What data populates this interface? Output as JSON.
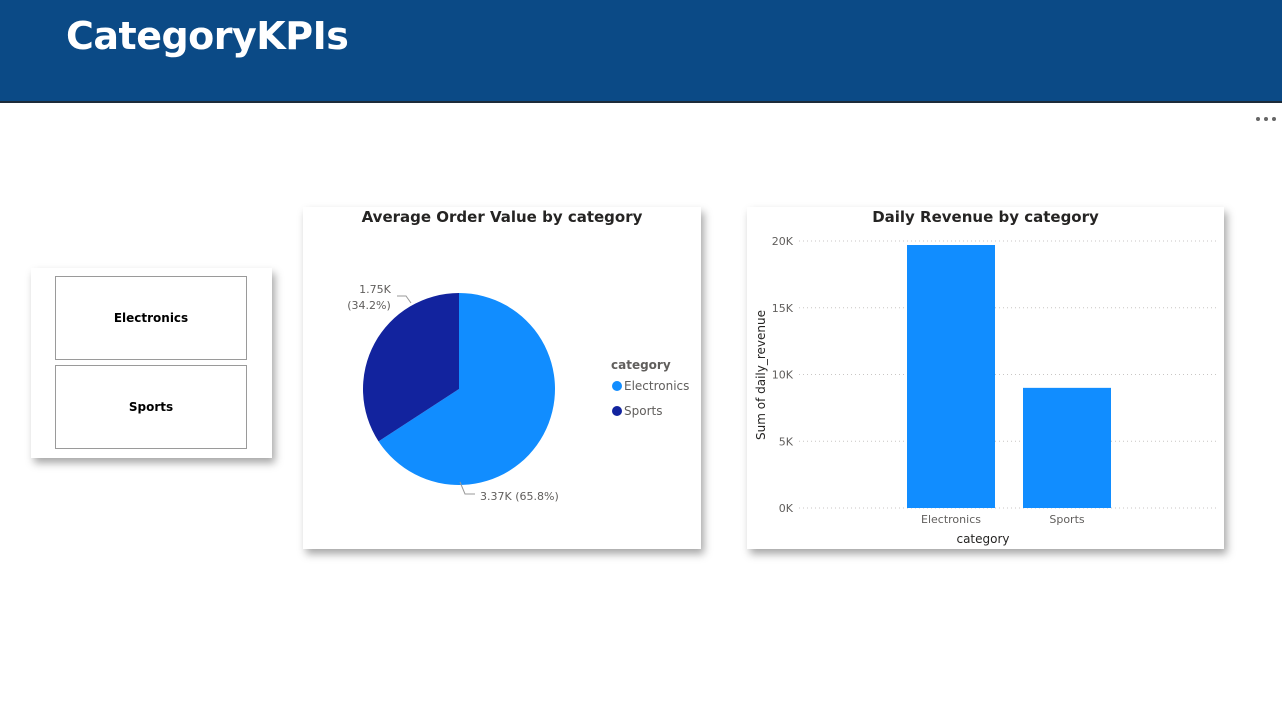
{
  "header": {
    "title": "CategoryKPIs"
  },
  "slicer": {
    "items": [
      "Electronics",
      "Sports"
    ]
  },
  "pie_chart": {
    "title": "Average Order Value by category",
    "legend_title": "category",
    "slices": [
      {
        "name": "Electronics",
        "value": 3370,
        "label": "3.37K (65.8%)",
        "color": "#118dff"
      },
      {
        "name": "Sports",
        "value": 1750,
        "label_line1": "1.75K",
        "label_line2": "(34.2%)",
        "color": "#12239e"
      }
    ]
  },
  "bar_chart": {
    "title": "Daily Revenue by category",
    "xlabel": "category",
    "ylabel": "Sum of daily_revenue",
    "y_ticks": [
      "0K",
      "5K",
      "10K",
      "15K",
      "20K"
    ],
    "color": "#118dff"
  },
  "chart_data": [
    {
      "type": "pie",
      "title": "Average Order Value by category",
      "categories": [
        "Electronics",
        "Sports"
      ],
      "values": [
        3370,
        1750
      ],
      "percentages": [
        65.8,
        34.2
      ],
      "legend": "right"
    },
    {
      "type": "bar",
      "title": "Daily Revenue by category",
      "categories": [
        "Electronics",
        "Sports"
      ],
      "values": [
        19700,
        9000
      ],
      "xlabel": "category",
      "ylabel": "Sum of daily_revenue",
      "ylim": [
        0,
        20000
      ],
      "grid": true
    }
  ]
}
